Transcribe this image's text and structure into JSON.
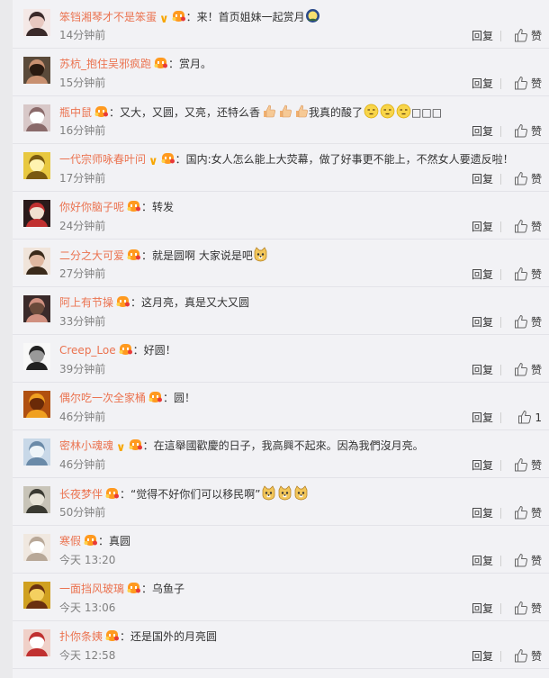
{
  "comments": [
    {
      "name": "笨铛湘琴才不是笨蛋",
      "vip": true,
      "pre": "：来！首页姐妹一起赏月",
      "emojis": [
        "moon"
      ],
      "post": "",
      "time": "14分钟前",
      "reply": "回复",
      "like": "赞"
    },
    {
      "name": "苏杭_抱住吴邪疯跑",
      "vip": false,
      "pre": "：赏月。",
      "emojis": [],
      "post": "",
      "time": "15分钟前",
      "reply": "回复",
      "like": "赞"
    },
    {
      "name": "瓶中鼠",
      "vip": false,
      "pre": "：又大，又圆，又亮，还特么香",
      "emojis": [
        "thumb",
        "thumb",
        "thumb"
      ],
      "post": "我真的酸了",
      "emojis2": [
        "speechless",
        "speechless",
        "speechless"
      ],
      "tail": "□□□",
      "time": "16分钟前",
      "reply": "回复",
      "like": "赞"
    },
    {
      "name": "一代宗师咏春叶问",
      "vip": true,
      "pre": "：国内:女人怎么能上大荧幕，做了好事更不能上，不然女人要遗反啦！",
      "emojis": [],
      "post": "",
      "time": "17分钟前",
      "reply": "回复",
      "like": "赞"
    },
    {
      "name": "你好你脑子呢",
      "vip": false,
      "pre": "：转发",
      "emojis": [],
      "post": "",
      "time": "24分钟前",
      "reply": "回复",
      "like": "赞"
    },
    {
      "name": "二分之大可爱",
      "vip": false,
      "pre": "：就是圆啊 大家说是吧",
      "emojis": [
        "doge"
      ],
      "post": "",
      "time": "27分钟前",
      "reply": "回复",
      "like": "赞"
    },
    {
      "name": "阿上有节操",
      "vip": false,
      "pre": "：这月亮，真是又大又圆",
      "emojis": [],
      "post": "",
      "time": "33分钟前",
      "reply": "回复",
      "like": "赞"
    },
    {
      "name": "Creep_Loe",
      "vip": false,
      "pre": "：好圆！",
      "emojis": [],
      "post": "",
      "time": "39分钟前",
      "reply": "回复",
      "like": "赞"
    },
    {
      "name": "偶尔吃一次全家桶",
      "vip": false,
      "pre": "：圆！",
      "emojis": [],
      "post": "",
      "time": "46分钟前",
      "reply": "回复",
      "like": "1"
    },
    {
      "name": "密林小魂魂",
      "vip": true,
      "pre": "：在這舉國歡慶的日子，我高興不起來。因為我們沒月亮。",
      "emojis": [],
      "post": "",
      "time": "46分钟前",
      "reply": "回复",
      "like": "赞"
    },
    {
      "name": "长夜梦伴",
      "vip": false,
      "pre": "：“觉得不好你们可以移民啊”",
      "emojis": [
        "doge",
        "doge",
        "doge"
      ],
      "post": "",
      "time": "50分钟前",
      "reply": "回复",
      "like": "赞"
    },
    {
      "name": "寒假",
      "vip": false,
      "pre": "：真圆",
      "emojis": [],
      "post": "",
      "time": "今天 13:20",
      "reply": "回复",
      "like": "赞"
    },
    {
      "name": "一面挡风玻璃",
      "vip": false,
      "pre": "：乌鱼子",
      "emojis": [],
      "post": "",
      "time": "今天 13:06",
      "reply": "回复",
      "like": "赞"
    },
    {
      "name": "扑你条姨",
      "vip": false,
      "pre": "：还是国外的月亮圆",
      "emojis": [],
      "post": "",
      "time": "今天 12:58",
      "reply": "回复",
      "like": "赞"
    }
  ],
  "colors": {
    "username": "#eb7350",
    "vip": "#f7a600",
    "time": "#808080",
    "background": "#f2f2f5"
  }
}
